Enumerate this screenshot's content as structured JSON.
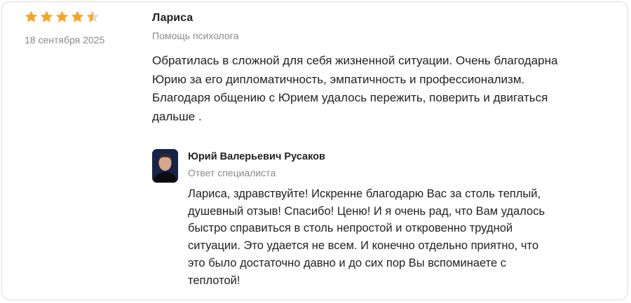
{
  "review": {
    "rating": 4.5,
    "max_rating": 5,
    "star_color": "#f5a623",
    "star_empty_color": "#dcdcdc",
    "date": "18 сентября 2025",
    "author": "Лариса",
    "service": "Помощь психолога",
    "text": "Обратилась в сложной для себя жизненной ситуации. Очень благодарна\nЮрию за его дипломатичность, эмпатичность и профессионализм.\nБлагодаря общению с Юрием удалось пережить, поверить и двигаться\nдальше ."
  },
  "reply": {
    "author": "Юрий Валерьевич Русаков",
    "role": "Ответ специалиста",
    "text": "Лариса, здравствуйте! Искренне благодарю Вас за столь теплый,\nдушевный отзыв! Спасибо! Ценю! И я очень рад, что Вам удалось\nбыстро справиться в столь непростой и откровенно трудной\nситуации. Это удается не всем. И конечно отдельно приятно, что\nэто было достаточно давно и до сих пор Вы вспоминаете с\nтеплотой!"
  }
}
